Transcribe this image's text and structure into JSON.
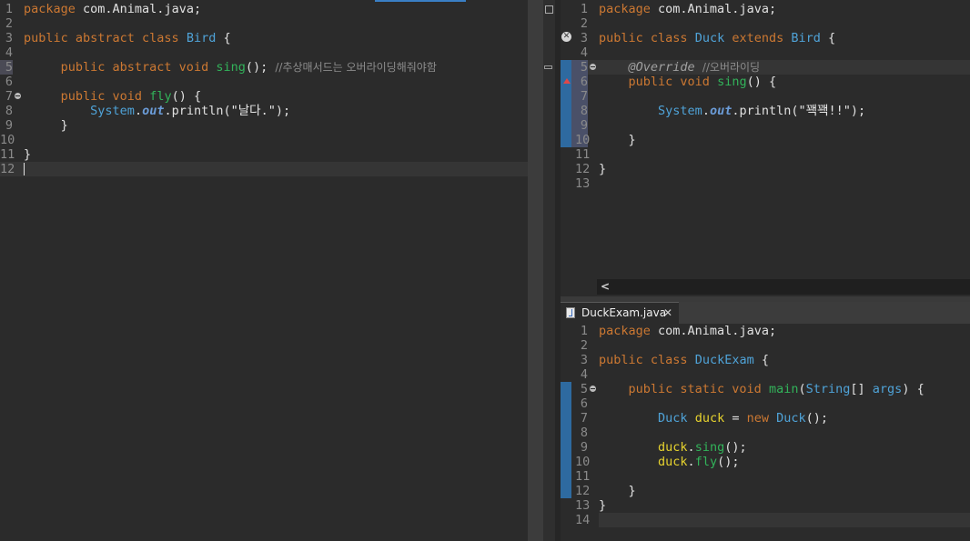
{
  "bird_editor": {
    "lines": [
      {
        "n": "1",
        "t": [
          {
            "c": "kw",
            "v": "package"
          },
          {
            "c": "plain",
            "v": " com.Animal.java;"
          }
        ]
      },
      {
        "n": "2",
        "t": []
      },
      {
        "n": "3",
        "t": [
          {
            "c": "kw",
            "v": "public abstract class"
          },
          {
            "c": "plain",
            "v": " "
          },
          {
            "c": "ty",
            "v": "Bird"
          },
          {
            "c": "plain",
            "v": " {"
          }
        ]
      },
      {
        "n": "4",
        "t": []
      },
      {
        "n": "5",
        "t": [
          {
            "c": "plain",
            "v": "     "
          },
          {
            "c": "kw",
            "v": "public abstract void"
          },
          {
            "c": "plain",
            "v": " "
          },
          {
            "c": "fn",
            "v": "sing"
          },
          {
            "c": "plain",
            "v": "(); "
          },
          {
            "c": "cm",
            "v": "//추상매서드는 오버라이딩해줘야함"
          }
        ]
      },
      {
        "n": "6",
        "t": []
      },
      {
        "n": "7",
        "fold": true,
        "t": [
          {
            "c": "plain",
            "v": "     "
          },
          {
            "c": "kw",
            "v": "public void"
          },
          {
            "c": "plain",
            "v": " "
          },
          {
            "c": "fn",
            "v": "fly"
          },
          {
            "c": "plain",
            "v": "() {"
          }
        ]
      },
      {
        "n": "8",
        "t": [
          {
            "c": "plain",
            "v": "         "
          },
          {
            "c": "ty",
            "v": "System"
          },
          {
            "c": "plain",
            "v": "."
          },
          {
            "c": "fld",
            "v": "out"
          },
          {
            "c": "plain",
            "v": ".println("
          },
          {
            "c": "str",
            "v": "\"날다.\""
          },
          {
            "c": "plain",
            "v": ");"
          }
        ]
      },
      {
        "n": "9",
        "t": [
          {
            "c": "plain",
            "v": "     }"
          }
        ]
      },
      {
        "n": "10",
        "t": []
      },
      {
        "n": "11",
        "t": [
          {
            "c": "plain",
            "v": "}"
          }
        ]
      },
      {
        "n": "12",
        "t": []
      }
    ]
  },
  "duck_editor": {
    "lines": [
      {
        "n": "1",
        "t": [
          {
            "c": "kw",
            "v": "package"
          },
          {
            "c": "plain",
            "v": " com.Animal.java;"
          }
        ]
      },
      {
        "n": "2",
        "t": []
      },
      {
        "n": "3",
        "t": [
          {
            "c": "kw",
            "v": "public class"
          },
          {
            "c": "plain",
            "v": " "
          },
          {
            "c": "ty",
            "v": "Duck"
          },
          {
            "c": "plain",
            "v": " "
          },
          {
            "c": "kw",
            "v": "extends"
          },
          {
            "c": "plain",
            "v": " "
          },
          {
            "c": "ty",
            "v": "Bird"
          },
          {
            "c": "plain",
            "v": " {"
          }
        ]
      },
      {
        "n": "4",
        "t": []
      },
      {
        "n": "5",
        "fold": true,
        "t": [
          {
            "c": "plain",
            "v": "    "
          },
          {
            "c": "ann",
            "v": "@Override"
          },
          {
            "c": "plain",
            "v": " "
          },
          {
            "c": "cm",
            "v": "//오버라이딩"
          }
        ]
      },
      {
        "n": "6",
        "t": [
          {
            "c": "plain",
            "v": "    "
          },
          {
            "c": "kw",
            "v": "public void"
          },
          {
            "c": "plain",
            "v": " "
          },
          {
            "c": "fn",
            "v": "sing"
          },
          {
            "c": "plain",
            "v": "() {"
          }
        ]
      },
      {
        "n": "7",
        "t": []
      },
      {
        "n": "8",
        "t": [
          {
            "c": "plain",
            "v": "        "
          },
          {
            "c": "ty",
            "v": "System"
          },
          {
            "c": "plain",
            "v": "."
          },
          {
            "c": "fld",
            "v": "out"
          },
          {
            "c": "plain",
            "v": ".println("
          },
          {
            "c": "str",
            "v": "\"꽥꽥!!\""
          },
          {
            "c": "plain",
            "v": ");"
          }
        ]
      },
      {
        "n": "9",
        "t": []
      },
      {
        "n": "10",
        "t": [
          {
            "c": "plain",
            "v": "    }"
          }
        ]
      },
      {
        "n": "11",
        "t": []
      },
      {
        "n": "12",
        "t": [
          {
            "c": "plain",
            "v": "}"
          }
        ]
      },
      {
        "n": "13",
        "t": []
      }
    ],
    "scroll_left_glyph": "<"
  },
  "duckexam_editor": {
    "tab_label": "DuckExam.java",
    "close_glyph": "✕",
    "lines": [
      {
        "n": "1",
        "t": [
          {
            "c": "kw",
            "v": "package"
          },
          {
            "c": "plain",
            "v": " com.Animal.java;"
          }
        ]
      },
      {
        "n": "2",
        "t": []
      },
      {
        "n": "3",
        "t": [
          {
            "c": "kw",
            "v": "public class"
          },
          {
            "c": "plain",
            "v": " "
          },
          {
            "c": "ty",
            "v": "DuckExam"
          },
          {
            "c": "plain",
            "v": " {"
          }
        ]
      },
      {
        "n": "4",
        "t": []
      },
      {
        "n": "5",
        "fold": true,
        "t": [
          {
            "c": "plain",
            "v": "    "
          },
          {
            "c": "kw",
            "v": "public static void"
          },
          {
            "c": "plain",
            "v": " "
          },
          {
            "c": "fn",
            "v": "main"
          },
          {
            "c": "plain",
            "v": "("
          },
          {
            "c": "ty",
            "v": "String"
          },
          {
            "c": "plain",
            "v": "[] "
          },
          {
            "c": "ty",
            "v": "args"
          },
          {
            "c": "plain",
            "v": ") {"
          }
        ]
      },
      {
        "n": "6",
        "t": []
      },
      {
        "n": "7",
        "t": [
          {
            "c": "plain",
            "v": "        "
          },
          {
            "c": "ty",
            "v": "Duck"
          },
          {
            "c": "plain",
            "v": " "
          },
          {
            "c": "var",
            "v": "duck"
          },
          {
            "c": "plain",
            "v": " = "
          },
          {
            "c": "kw",
            "v": "new"
          },
          {
            "c": "plain",
            "v": " "
          },
          {
            "c": "ty",
            "v": "Duck"
          },
          {
            "c": "plain",
            "v": "();"
          }
        ]
      },
      {
        "n": "8",
        "t": []
      },
      {
        "n": "9",
        "t": [
          {
            "c": "plain",
            "v": "        "
          },
          {
            "c": "var",
            "v": "duck"
          },
          {
            "c": "plain",
            "v": "."
          },
          {
            "c": "fn",
            "v": "sing"
          },
          {
            "c": "plain",
            "v": "();"
          }
        ]
      },
      {
        "n": "10",
        "t": [
          {
            "c": "plain",
            "v": "        "
          },
          {
            "c": "var",
            "v": "duck"
          },
          {
            "c": "plain",
            "v": "."
          },
          {
            "c": "fn",
            "v": "fly"
          },
          {
            "c": "plain",
            "v": "();"
          }
        ]
      },
      {
        "n": "11",
        "t": []
      },
      {
        "n": "12",
        "t": [
          {
            "c": "plain",
            "v": "    }"
          }
        ]
      },
      {
        "n": "13",
        "t": [
          {
            "c": "plain",
            "v": "}"
          }
        ]
      },
      {
        "n": "14",
        "t": []
      }
    ]
  },
  "colors": {
    "editor_bg": "#2b2b2b",
    "gutter_bg": "#2b2b2b",
    "current_line": "#353535",
    "keyword": "#cc7832",
    "type": "#4fa3d8",
    "method": "#32b35a",
    "variable": "#e6d22e",
    "diff_marker": "#2e6aa0"
  }
}
